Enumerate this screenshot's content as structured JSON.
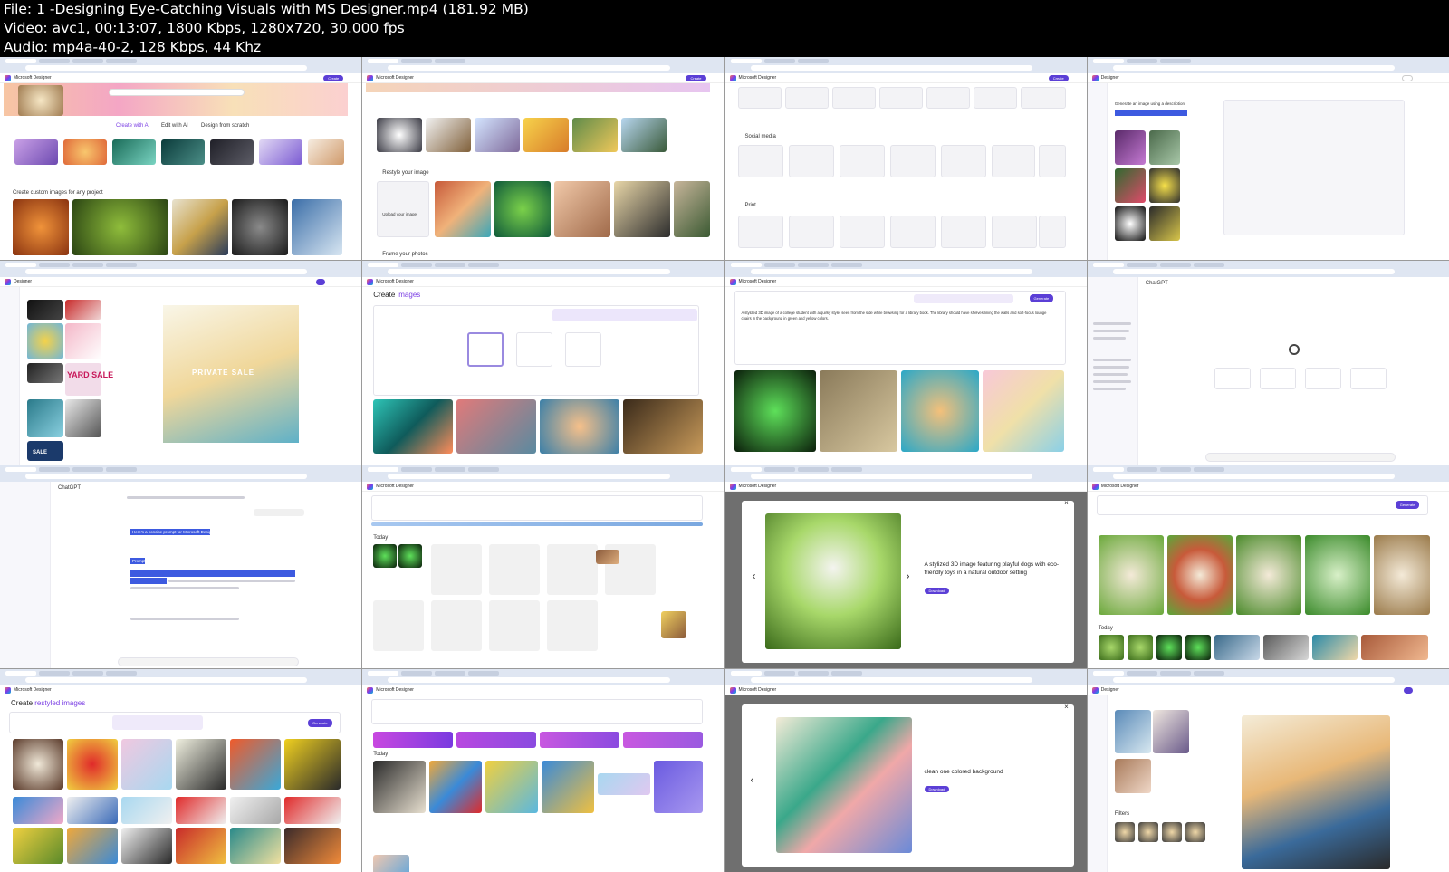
{
  "header": {
    "file_line": "File: 1 -Designing Eye-Catching Visuals with MS Designer.mp4 (181.92 MB)",
    "video_line": "Video: avc1, 00:13:07, 1800 Kbps, 1280x720, 30.000 fps",
    "audio_line": "Audio: mp4a-40-2, 128 Kbps, 44 Khz"
  },
  "tiles": {
    "t1": {
      "create_ai": "Create with AI",
      "edit_ai": "Edit with AI",
      "scratch": "Design from scratch",
      "section": "Create custom images for any project"
    },
    "t2": {
      "restyle": "Restyle your image",
      "frame": "Frame your photos",
      "upload": "Upload your image"
    },
    "t3": {
      "social": "Social media",
      "print": "Print"
    },
    "t4": {
      "prompt": "Generate an image using a description"
    },
    "t5": {
      "sale": "PRIVATE SALE",
      "yard": "YARD SALE",
      "sale2": "SALE"
    },
    "t6": {
      "title_a": "Create ",
      "title_b": "images"
    },
    "t7": {
      "generate": "Generate",
      "prompt": "A stylized 3D image of a college student with a quirky style, seen from the side while browsing for a library book. The library should have shelves lining the walls and soft-focus lounge chairs in the background in green and yellow colors."
    },
    "t8": {
      "app": "ChatGPT"
    },
    "t9": {
      "h1": "Here's a concise prompt for Microsoft Designer:",
      "h2": "Prompt:"
    },
    "t10": {
      "today": "Today"
    },
    "t11": {
      "caption": "A stylized 3D image featuring playful dogs with eco-friendly toys in a natural outdoor setting",
      "download": "Download"
    },
    "t12": {
      "generate": "Generate",
      "today": "Today"
    },
    "t13": {
      "title_a": "Create ",
      "title_b": "restyled images",
      "generate": "Generate"
    },
    "t14": {
      "today": "Today"
    },
    "t15": {
      "caption": "clean one colored background",
      "download": "Download"
    },
    "t16": {
      "filters": "Filters"
    }
  },
  "app": {
    "brand": "Microsoft Designer",
    "create": "Create",
    "designer": "Designer"
  }
}
